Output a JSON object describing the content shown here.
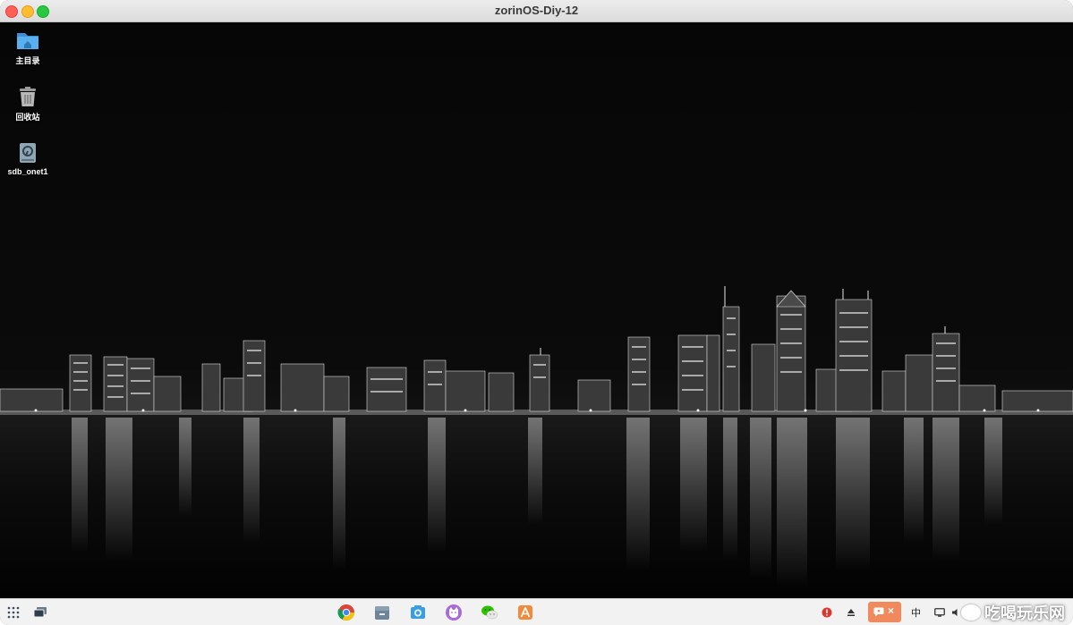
{
  "window": {
    "title": "zorinOS-Diy-12"
  },
  "desktop": {
    "icons": [
      {
        "label": "主目录",
        "icon": "home-folder-icon"
      },
      {
        "label": "回收站",
        "icon": "trash-icon"
      },
      {
        "label": "sdb_onet1",
        "icon": "drive-icon"
      }
    ]
  },
  "taskbar": {
    "left": [
      "app-grid-icon",
      "workspaces-icon"
    ],
    "apps": [
      "chrome-icon",
      "files-icon",
      "screenshot-icon",
      "cat-app-icon",
      "wechat-icon",
      "appstore-icon"
    ],
    "tray": {
      "input_method": "中",
      "notification_close": "×"
    }
  },
  "watermark": {
    "text": "吃喝玩乐网"
  },
  "colors": {
    "titlebar": "#e4e4e4",
    "taskbar": "#f2f2f2",
    "close": "#ff5f57",
    "minimize": "#febc2e",
    "maximize": "#28c840",
    "folder": "#5ab0ef",
    "tray_alert": "#e0342f",
    "tray_notice": "#f08a5d"
  }
}
